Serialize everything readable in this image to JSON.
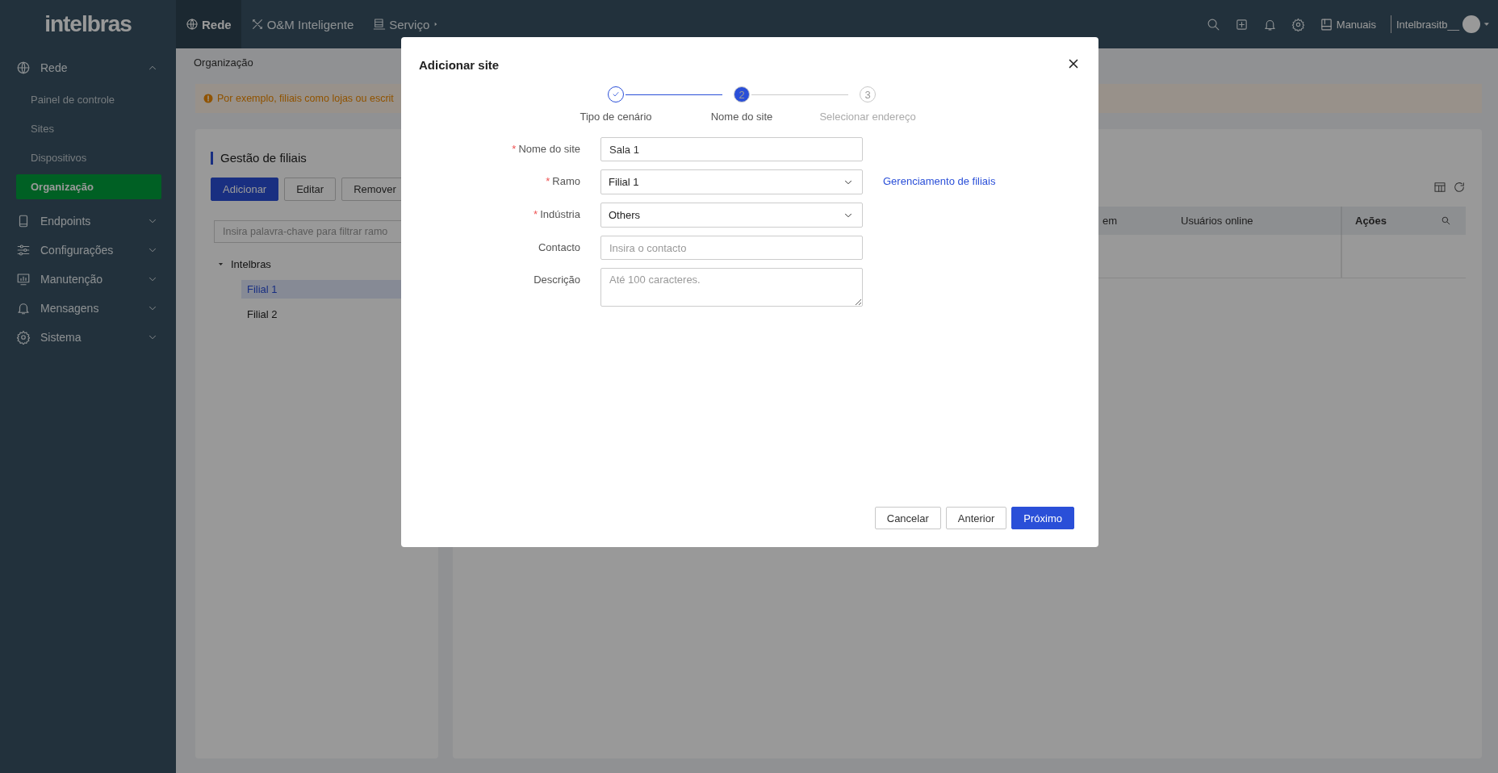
{
  "topbar": {
    "logo": "intelbras",
    "nav": [
      {
        "label": "Rede",
        "selected": true,
        "dropdown": false
      },
      {
        "label": "O&M Inteligente",
        "selected": false,
        "dropdown": false
      },
      {
        "label": "Serviço",
        "selected": false,
        "dropdown": true
      }
    ],
    "manuals": "Manuais",
    "user": "Intelbrasitb__"
  },
  "sidebar": {
    "items": [
      {
        "label": "Rede",
        "expanded": true,
        "children": [
          {
            "label": "Painel de controle",
            "selected": false
          },
          {
            "label": "Sites",
            "selected": false
          },
          {
            "label": "Dispositivos",
            "selected": false
          },
          {
            "label": "Organização",
            "selected": true
          }
        ]
      },
      {
        "label": "Endpoints",
        "expanded": false
      },
      {
        "label": "Configurações",
        "expanded": false
      },
      {
        "label": "Manutenção",
        "expanded": false
      },
      {
        "label": "Mensagens",
        "expanded": false
      },
      {
        "label": "Sistema",
        "expanded": false
      }
    ]
  },
  "breadcrumb": "Organização",
  "alert": "Por exemplo, filiais como lojas ou escrit",
  "branch_panel": {
    "title": "Gestão de filiais",
    "buttons": [
      {
        "label": "Adicionar",
        "kind": "primary"
      },
      {
        "label": "Editar",
        "kind": "default"
      },
      {
        "label": "Remover",
        "kind": "default"
      }
    ],
    "filter_placeholder": "Insira palavra-chave para filtrar ramo",
    "tree": [
      {
        "label": "Intelbras",
        "expanded": true,
        "children": [
          {
            "label": "Filial 1",
            "selected": true
          },
          {
            "label": "Filial 2",
            "selected": false
          }
        ]
      }
    ]
  },
  "site_table": {
    "columns": [
      {
        "label": "em",
        "bold": false
      },
      {
        "label": "Usuários online",
        "bold": false
      },
      {
        "label": "Ações",
        "bold": true
      }
    ]
  },
  "dialog": {
    "title": "Adicionar site",
    "steps": [
      {
        "label": "Tipo de cenário",
        "done": true,
        "selected": false
      },
      {
        "number": "2",
        "label": "Nome do site",
        "done": false,
        "selected": true
      },
      {
        "number": "3",
        "label": "Selecionar endereço",
        "done": false,
        "selected": false
      }
    ],
    "fields": [
      {
        "label": "Nome do site",
        "marker": "*",
        "kind": "input",
        "value": "Sala 1"
      },
      {
        "label": "Ramo",
        "marker": "*",
        "kind": "select",
        "value": "Filial 1",
        "link": "Gerenciamento de filiais"
      },
      {
        "label": "Indústria",
        "marker": "*",
        "kind": "select",
        "value": "Others"
      },
      {
        "label": "Contacto",
        "kind": "input",
        "placeholder": "Insira o contacto"
      },
      {
        "label": "Descrição",
        "kind": "textarea",
        "placeholder": "Até 100 caracteres."
      }
    ],
    "buttons": [
      {
        "label": "Cancelar",
        "kind": "default"
      },
      {
        "label": "Anterior",
        "kind": "default"
      },
      {
        "label": "Próximo",
        "kind": "primary"
      }
    ]
  }
}
